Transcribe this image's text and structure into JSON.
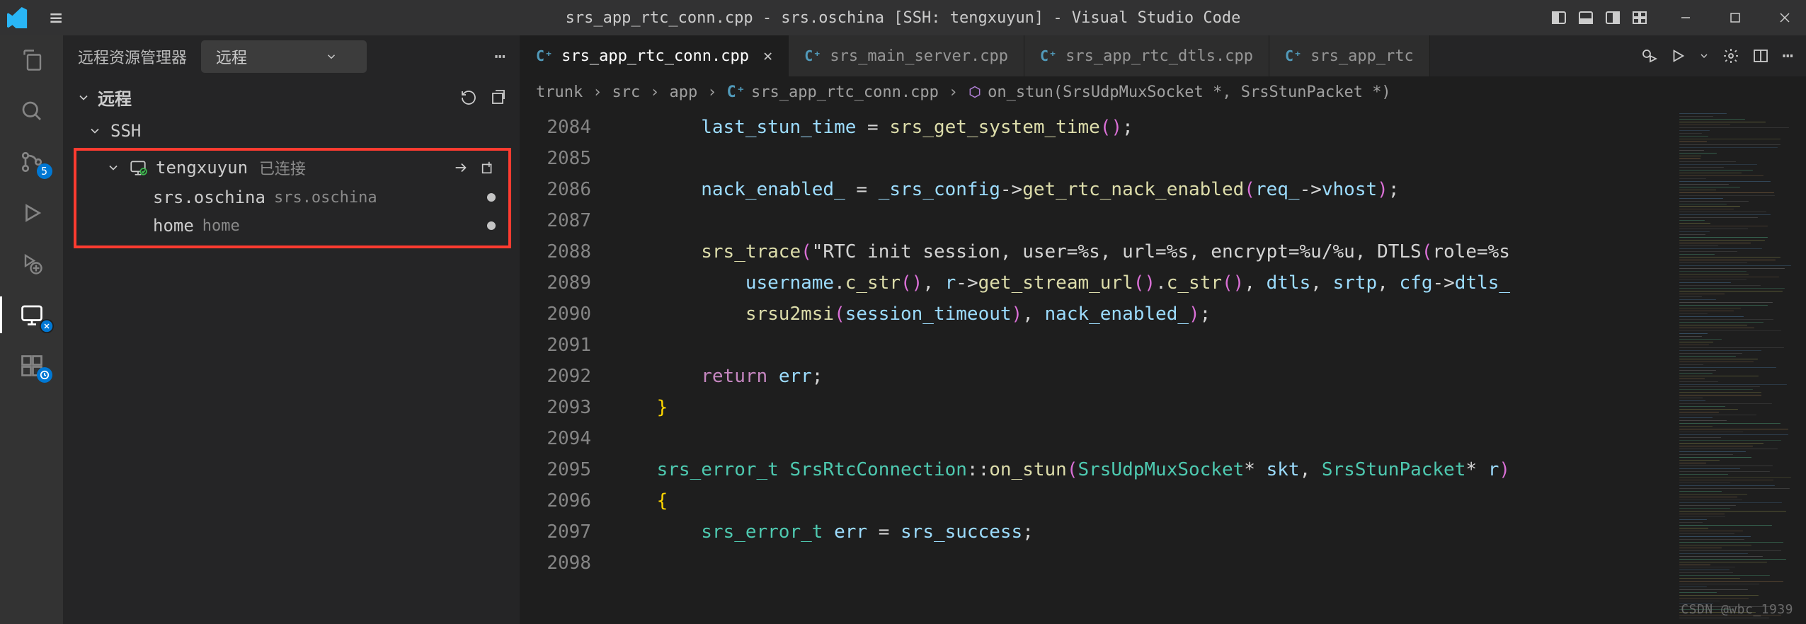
{
  "title": "srs_app_rtc_conn.cpp - srs.oschina [SSH: tengxuyun] - Visual Studio Code",
  "sidebar": {
    "title": "远程资源管理器",
    "selectLabel": "远程",
    "sectionLabel": "远程",
    "ssh": {
      "label": "SSH",
      "host": {
        "name": "tengxuyun",
        "status": "已连接"
      },
      "folders": [
        {
          "name": "srs.oschina",
          "desc": "srs.oschina"
        },
        {
          "name": "home",
          "desc": "home"
        }
      ]
    }
  },
  "activitybar": {
    "scmBadge": "5"
  },
  "tabs": [
    {
      "name": "srs_app_rtc_conn.cpp",
      "active": true,
      "closeable": true
    },
    {
      "name": "srs_main_server.cpp",
      "active": false
    },
    {
      "name": "srs_app_rtc_dtls.cpp",
      "active": false
    },
    {
      "name": "srs_app_rtc",
      "active": false,
      "truncated": true
    }
  ],
  "breadcrumbs": {
    "segments": [
      "trunk",
      "src",
      "app",
      "srs_app_rtc_conn.cpp"
    ],
    "symbol": "on_stun(SrsUdpMuxSocket *, SrsStunPacket *)"
  },
  "lineStart": 2084,
  "code_lines": [
    "        last_stun_time = srs_get_system_time();",
    "",
    "        nack_enabled_ = _srs_config->get_rtc_nack_enabled(req_->vhost);",
    "",
    "        srs_trace(\"RTC init session, user=%s, url=%s, encrypt=%u/%u, DTLS(role=%s",
    "            username.c_str(), r->get_stream_url().c_str(), dtls, srtp, cfg->dtls_",
    "            srsu2msi(session_timeout), nack_enabled_);",
    "",
    "        return err;",
    "    }",
    "",
    "    srs_error_t SrsRtcConnection::on_stun(SrsUdpMuxSocket* skt, SrsStunPacket* r)",
    "    {",
    "        srs_error_t err = srs_success;",
    ""
  ],
  "watermark": "CSDN @wbc_1939"
}
